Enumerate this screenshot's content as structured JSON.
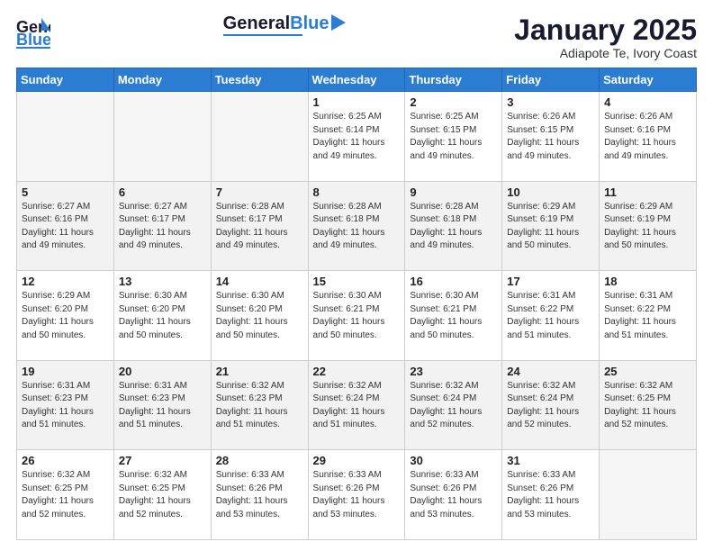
{
  "header": {
    "logo_general": "General",
    "logo_blue": "Blue",
    "month_title": "January 2025",
    "location": "Adiapote Te, Ivory Coast"
  },
  "days_of_week": [
    "Sunday",
    "Monday",
    "Tuesday",
    "Wednesday",
    "Thursday",
    "Friday",
    "Saturday"
  ],
  "weeks": [
    [
      {
        "num": "",
        "sunrise": "",
        "sunset": "",
        "daylight": ""
      },
      {
        "num": "",
        "sunrise": "",
        "sunset": "",
        "daylight": ""
      },
      {
        "num": "",
        "sunrise": "",
        "sunset": "",
        "daylight": ""
      },
      {
        "num": "1",
        "sunrise": "Sunrise: 6:25 AM",
        "sunset": "Sunset: 6:14 PM",
        "daylight": "Daylight: 11 hours and 49 minutes."
      },
      {
        "num": "2",
        "sunrise": "Sunrise: 6:25 AM",
        "sunset": "Sunset: 6:15 PM",
        "daylight": "Daylight: 11 hours and 49 minutes."
      },
      {
        "num": "3",
        "sunrise": "Sunrise: 6:26 AM",
        "sunset": "Sunset: 6:15 PM",
        "daylight": "Daylight: 11 hours and 49 minutes."
      },
      {
        "num": "4",
        "sunrise": "Sunrise: 6:26 AM",
        "sunset": "Sunset: 6:16 PM",
        "daylight": "Daylight: 11 hours and 49 minutes."
      }
    ],
    [
      {
        "num": "5",
        "sunrise": "Sunrise: 6:27 AM",
        "sunset": "Sunset: 6:16 PM",
        "daylight": "Daylight: 11 hours and 49 minutes."
      },
      {
        "num": "6",
        "sunrise": "Sunrise: 6:27 AM",
        "sunset": "Sunset: 6:17 PM",
        "daylight": "Daylight: 11 hours and 49 minutes."
      },
      {
        "num": "7",
        "sunrise": "Sunrise: 6:28 AM",
        "sunset": "Sunset: 6:17 PM",
        "daylight": "Daylight: 11 hours and 49 minutes."
      },
      {
        "num": "8",
        "sunrise": "Sunrise: 6:28 AM",
        "sunset": "Sunset: 6:18 PM",
        "daylight": "Daylight: 11 hours and 49 minutes."
      },
      {
        "num": "9",
        "sunrise": "Sunrise: 6:28 AM",
        "sunset": "Sunset: 6:18 PM",
        "daylight": "Daylight: 11 hours and 49 minutes."
      },
      {
        "num": "10",
        "sunrise": "Sunrise: 6:29 AM",
        "sunset": "Sunset: 6:19 PM",
        "daylight": "Daylight: 11 hours and 50 minutes."
      },
      {
        "num": "11",
        "sunrise": "Sunrise: 6:29 AM",
        "sunset": "Sunset: 6:19 PM",
        "daylight": "Daylight: 11 hours and 50 minutes."
      }
    ],
    [
      {
        "num": "12",
        "sunrise": "Sunrise: 6:29 AM",
        "sunset": "Sunset: 6:20 PM",
        "daylight": "Daylight: 11 hours and 50 minutes."
      },
      {
        "num": "13",
        "sunrise": "Sunrise: 6:30 AM",
        "sunset": "Sunset: 6:20 PM",
        "daylight": "Daylight: 11 hours and 50 minutes."
      },
      {
        "num": "14",
        "sunrise": "Sunrise: 6:30 AM",
        "sunset": "Sunset: 6:20 PM",
        "daylight": "Daylight: 11 hours and 50 minutes."
      },
      {
        "num": "15",
        "sunrise": "Sunrise: 6:30 AM",
        "sunset": "Sunset: 6:21 PM",
        "daylight": "Daylight: 11 hours and 50 minutes."
      },
      {
        "num": "16",
        "sunrise": "Sunrise: 6:30 AM",
        "sunset": "Sunset: 6:21 PM",
        "daylight": "Daylight: 11 hours and 50 minutes."
      },
      {
        "num": "17",
        "sunrise": "Sunrise: 6:31 AM",
        "sunset": "Sunset: 6:22 PM",
        "daylight": "Daylight: 11 hours and 51 minutes."
      },
      {
        "num": "18",
        "sunrise": "Sunrise: 6:31 AM",
        "sunset": "Sunset: 6:22 PM",
        "daylight": "Daylight: 11 hours and 51 minutes."
      }
    ],
    [
      {
        "num": "19",
        "sunrise": "Sunrise: 6:31 AM",
        "sunset": "Sunset: 6:23 PM",
        "daylight": "Daylight: 11 hours and 51 minutes."
      },
      {
        "num": "20",
        "sunrise": "Sunrise: 6:31 AM",
        "sunset": "Sunset: 6:23 PM",
        "daylight": "Daylight: 11 hours and 51 minutes."
      },
      {
        "num": "21",
        "sunrise": "Sunrise: 6:32 AM",
        "sunset": "Sunset: 6:23 PM",
        "daylight": "Daylight: 11 hours and 51 minutes."
      },
      {
        "num": "22",
        "sunrise": "Sunrise: 6:32 AM",
        "sunset": "Sunset: 6:24 PM",
        "daylight": "Daylight: 11 hours and 51 minutes."
      },
      {
        "num": "23",
        "sunrise": "Sunrise: 6:32 AM",
        "sunset": "Sunset: 6:24 PM",
        "daylight": "Daylight: 11 hours and 52 minutes."
      },
      {
        "num": "24",
        "sunrise": "Sunrise: 6:32 AM",
        "sunset": "Sunset: 6:24 PM",
        "daylight": "Daylight: 11 hours and 52 minutes."
      },
      {
        "num": "25",
        "sunrise": "Sunrise: 6:32 AM",
        "sunset": "Sunset: 6:25 PM",
        "daylight": "Daylight: 11 hours and 52 minutes."
      }
    ],
    [
      {
        "num": "26",
        "sunrise": "Sunrise: 6:32 AM",
        "sunset": "Sunset: 6:25 PM",
        "daylight": "Daylight: 11 hours and 52 minutes."
      },
      {
        "num": "27",
        "sunrise": "Sunrise: 6:32 AM",
        "sunset": "Sunset: 6:25 PM",
        "daylight": "Daylight: 11 hours and 52 minutes."
      },
      {
        "num": "28",
        "sunrise": "Sunrise: 6:33 AM",
        "sunset": "Sunset: 6:26 PM",
        "daylight": "Daylight: 11 hours and 53 minutes."
      },
      {
        "num": "29",
        "sunrise": "Sunrise: 6:33 AM",
        "sunset": "Sunset: 6:26 PM",
        "daylight": "Daylight: 11 hours and 53 minutes."
      },
      {
        "num": "30",
        "sunrise": "Sunrise: 6:33 AM",
        "sunset": "Sunset: 6:26 PM",
        "daylight": "Daylight: 11 hours and 53 minutes."
      },
      {
        "num": "31",
        "sunrise": "Sunrise: 6:33 AM",
        "sunset": "Sunset: 6:26 PM",
        "daylight": "Daylight: 11 hours and 53 minutes."
      },
      {
        "num": "",
        "sunrise": "",
        "sunset": "",
        "daylight": ""
      }
    ]
  ]
}
